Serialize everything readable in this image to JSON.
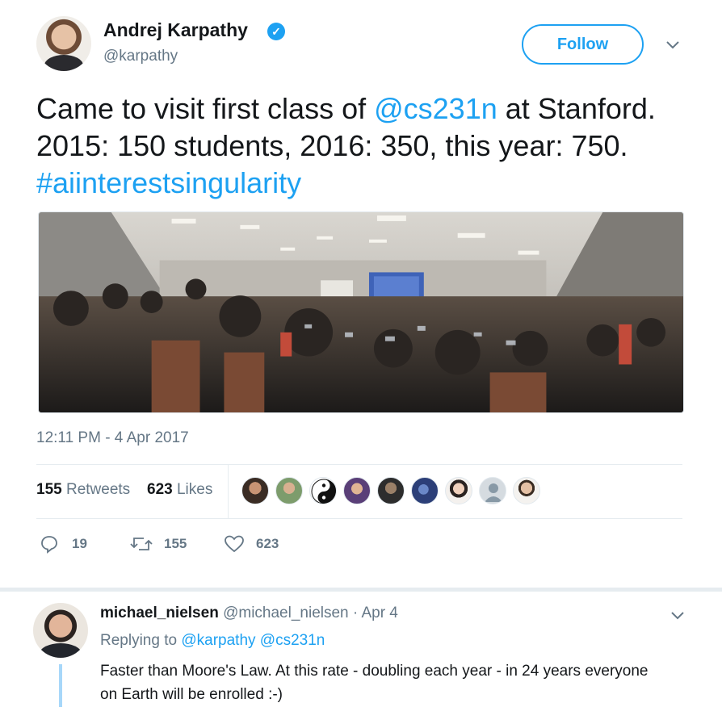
{
  "tweet": {
    "author_name": "Andrej Karpathy",
    "author_handle": "@karpathy",
    "follow_label": "Follow",
    "text_1": "Came to visit first class of ",
    "mention": "@cs231n",
    "text_2": " at Stanford. 2015: 150 students, 2016: 350, this year: 750. ",
    "hashtag": "#aiinterestsingularity",
    "timestamp": "12:11 PM - 4 Apr 2017"
  },
  "stats": {
    "retweets_count": "155",
    "retweets_label": "Retweets",
    "likes_count": "623",
    "likes_label": "Likes"
  },
  "actions": {
    "replies": "19",
    "retweets": "155",
    "likes": "623"
  },
  "reply": {
    "name": "michael_nielsen",
    "handle": "@michael_nielsen",
    "date": " · Apr 4",
    "replying_label": "Replying to ",
    "replying_to_1": "@karpathy",
    "replying_to_2": "@cs231n",
    "text": "Faster than Moore's Law.  At this rate - doubling each year - in 24 years everyone on Earth will be enrolled :-)"
  },
  "colors": {
    "accent": "#1da1f2",
    "muted": "#657786",
    "text": "#14171a",
    "thread": "#a7d7f9"
  },
  "icons": [
    "verified-badge-icon",
    "chevron-down-icon",
    "reply-icon",
    "retweet-icon",
    "like-icon"
  ]
}
